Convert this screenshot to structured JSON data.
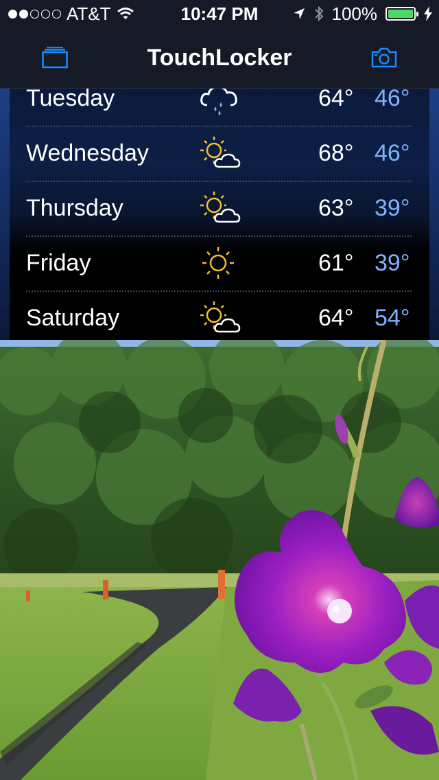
{
  "status_bar": {
    "carrier": "AT&T",
    "time": "10:47 PM",
    "battery": "100%",
    "battery_level": 1.0,
    "signal_strength_filled": 2,
    "signal_strength_total": 5,
    "icons": [
      "wifi-icon",
      "location-arrow-icon",
      "bluetooth-icon",
      "battery-icon",
      "charging-bolt-icon"
    ]
  },
  "nav_bar": {
    "title": "TouchLocker",
    "left_icon": "stack-icon",
    "right_icon": "camera-icon"
  },
  "forecast": [
    {
      "day": "Tuesday",
      "icon": "cloud-rain-icon",
      "high": "64°",
      "low": "46°"
    },
    {
      "day": "Wednesday",
      "icon": "sun-cloud-icon",
      "high": "68°",
      "low": "46°"
    },
    {
      "day": "Thursday",
      "icon": "sun-cloud-icon",
      "high": "63°",
      "low": "39°"
    },
    {
      "day": "Friday",
      "icon": "sun-icon",
      "high": "61°",
      "low": "39°"
    },
    {
      "day": "Saturday",
      "icon": "sun-cloud-icon",
      "high": "64°",
      "low": "54°"
    }
  ],
  "colors": {
    "accent": "#1a8cff",
    "low_temp": "#7fb3ff",
    "sun": "#f2c12e",
    "battery": "#4cd964",
    "bar_background": "#151a26"
  }
}
